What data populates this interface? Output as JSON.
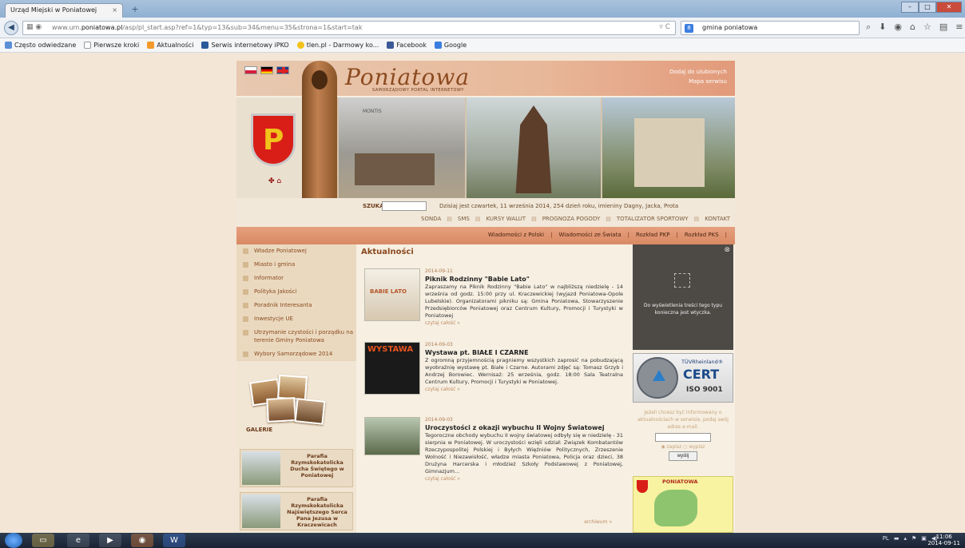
{
  "browser": {
    "tab_title": "Urząd Miejski w Poniatowej",
    "tab_close": "×",
    "new_tab": "+",
    "url_prefix": "www.um.",
    "url_domain": "poniatowa.pl",
    "url_path": "/asp/pl_start.asp?ref=1&typ=13&sub=34&menu=35&strona=1&start=tak",
    "search_value": "gmina poniatowa",
    "window_buttons": [
      "–",
      "□",
      "✕"
    ]
  },
  "bookmarks": [
    {
      "label": "Często odwiedzane",
      "icon": "bookmark-folder-icon"
    },
    {
      "label": "Pierwsze kroki",
      "icon": "page-icon"
    },
    {
      "label": "Aktualności",
      "icon": "rss-icon"
    },
    {
      "label": "Serwis internetowy iPKO",
      "icon": "bank-icon"
    },
    {
      "label": "tlen.pl - Darmowy ko...",
      "icon": "tlen-icon"
    },
    {
      "label": "Facebook",
      "icon": "facebook-icon"
    },
    {
      "label": "Google",
      "icon": "google-icon"
    }
  ],
  "site": {
    "logo": "Poniatowa",
    "logo_sub": "SAMORZĄDOWY PORTAL INTERNETOWY",
    "top_links": [
      "Dodaj do ulubionych",
      "Mapa serwisu"
    ],
    "photo_sign": "MONTIS",
    "search_label": "SZUKAJ",
    "date_line": "Dzisiaj jest czwartek, 11 września 2014, 254 dzień roku, imieniny Dagny, Jacka, Prota",
    "util_links": [
      "SONDA",
      "SMS",
      "KURSY WALUT",
      "PROGNOZA POGODY",
      "TOTALIZATOR SPORTOWY",
      "KONTAKT"
    ],
    "nav_links": [
      "Wiadomości z Polski",
      "Wiadomości ze Świata",
      "Rozkład PKP",
      "Rozkład PKS"
    ],
    "menu": [
      "Władze Poniatowej",
      "Miasto i gmina",
      "Informator",
      "Polityka Jakości",
      "Poradnik Interesanta",
      "Inwestycje UE",
      "Utrzymanie czystości i porządku na terenie Gminy Poniatowa",
      "Wybory Samorządowe 2014"
    ],
    "gallery_label": "GALERIE",
    "parishes": [
      "Parafia Rzymskokatolicka Ducha Świętego w Poniatowej",
      "Parafia Rzymskokatolicka Najświętszego Serca Pana Jezusa w Kraczewicach"
    ],
    "section_title": "Aktualności",
    "news": [
      {
        "date": "2014-09-11",
        "title": "Piknik Rodzinny \"Babie Lato\"",
        "text": "Zapraszamy na Piknik Rodzinny \"Babie Lato\" w najbliższą niedzielę - 14 września od godz. 15:00 przy ul. Kraczewickiej (wyjazd Poniatowa-Opole Lubelskie). Organizatorami pikniku są: Gmina Poniatowa, Stowarzyszenie Przedsiębiorców Poniatowej oraz Centrum Kultury, Promocji i Turystyki w Poniatowej",
        "more": "czytaj całość »",
        "thumb_label": "BABIE LATO"
      },
      {
        "date": "2014-09-03",
        "title": "Wystawa pt. BIAŁE I CZARNE",
        "text": "Z ogromną przyjemnością pragniemy wszystkich zaprosić na pobudzającą wyobraźnię wystawę pt. Białe i Czarne. Autorami zdjęć są: Tomasz Grzyb i Andrzej Borowiec. Wernisaż: 25 września, godz. 18:00 Sala Teatralna Centrum Kultury, Promocji i Turystyki w Poniatowej.",
        "more": "czytaj całość »",
        "thumb_label": "WYSTAWA"
      },
      {
        "date": "2014-09-03",
        "title": "Uroczystości z okazji wybuchu II Wojny Światowej",
        "text": "Tegoroczne obchody wybuchu II wojny światowej odbyły się w niedzielę - 31 sierpnia w Poniatowej. W uroczystości wzięli udział: Związek Kombatantów Rzeczypospolitej Polskiej i Byłych Więźniów Politycznych, Zrzeszenie Wolność i Niezawisłość, władze miasta Poniatowa, Policja oraz dzieci, 38 Drużyna Harcerska i młodzież Szkoły Podstawowej z Poniatowej, Gimnazjum...",
        "more": "czytaj całość »",
        "thumb_label": ""
      }
    ],
    "archive": "archiwum »",
    "plugin_close": "⊗",
    "plugin_text": "Do wyświetlenia treści tego typu konieczna jest wtyczka.",
    "cert_brand": "TÜVRheinland®",
    "cert_big": "CERT",
    "cert_iso": "ISO 9001",
    "newsletter_text": "Jeżeli chcesz być informowany o aktualnościach w serwisie, podaj swój adres e-mail.",
    "newsletter_radio1": "zapisz",
    "newsletter_radio2": "wypisz",
    "newsletter_btn": "wyślij",
    "map_title": "PONIATOWA"
  },
  "taskbar": {
    "lang": "PL",
    "time": "11:06",
    "date": "2014-09-11"
  }
}
